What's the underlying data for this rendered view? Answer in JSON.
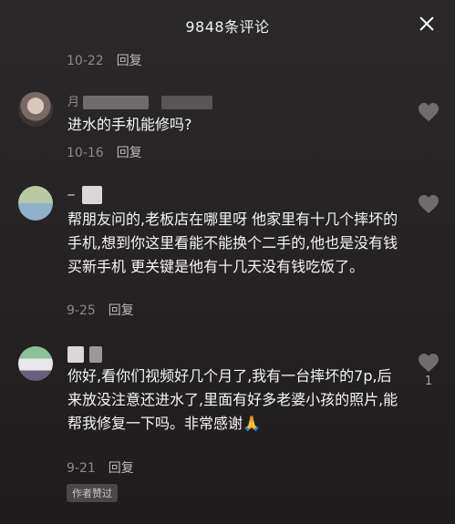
{
  "header": {
    "title": "9848条评论"
  },
  "first_meta": {
    "date": "10-22",
    "reply": "回复"
  },
  "comments": [
    {
      "username": "月",
      "username_tail": "",
      "text": "进水的手机能修吗?",
      "date": "10-16",
      "reply": "回复",
      "likes": ""
    },
    {
      "username": "",
      "text": "帮朋友问的,老板店在哪里呀 他家里有十几个摔坏的手机,想到你这里看能不能换个二手的,他也是没有钱买新手机 更关键是他有十几天没有钱吃饭了。",
      "date": "9-25",
      "reply": "回复",
      "likes": ""
    },
    {
      "username": "",
      "text": "你好,看你们视频好几个月了,我有一台摔坏的7p,后来放没注意还进水了,里面有好多老婆小孩的照片,能帮我修复一下吗。非常感谢🙏",
      "date": "9-21",
      "reply": "回复",
      "likes": "1",
      "badge": "作者赞过"
    }
  ],
  "colors": {
    "background": "#2a2728",
    "text": "#f5f5f5",
    "muted": "#8c8a8b"
  }
}
